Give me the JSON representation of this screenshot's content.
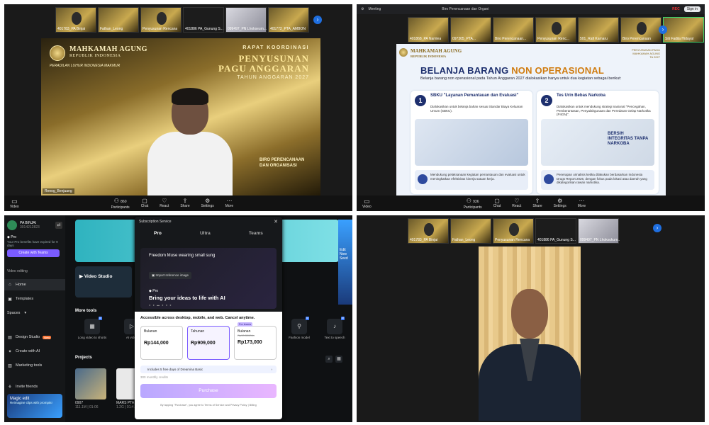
{
  "q1": {
    "participants": [
      "401783_PA Binjai",
      "Fathan_Leong",
      "Penyusunan Rencana",
      "401886 PA_Gunung S...",
      "099497_PN Lhokseum...",
      "401772_PTA_AMBON"
    ],
    "banner": {
      "institution": "MAHKAMAH AGUNG",
      "republic": "REPUBLIK INDONESIA",
      "motto": "PERADILAN LUHUR INDONESIA MAKMUR",
      "meeting": "RAPAT KOORDINASI",
      "title_line1": "PENYUSUNAN",
      "title_line2": "PAGU ANGGARAN",
      "year": "TAHUN ANGGARAN 2027",
      "dept_line1": "BIRO PERENCANAAN",
      "dept_line2": "DAN ORGANISASI"
    },
    "name_tag": "Renog_Benjuang",
    "toolbar": {
      "video": "Video",
      "participants": "Participants",
      "participants_count": "860",
      "chat": "Chat",
      "react": "React",
      "share": "Share",
      "settings": "Settings",
      "more": "More"
    }
  },
  "q2": {
    "browser": {
      "tab": "Meeting",
      "title": "Biro Perencanaan dan Organi",
      "rec": "REC",
      "signin": "Sign in"
    },
    "participants": [
      "401868_PA Namlea",
      "097305_PTA...",
      "Biro Perencanaan...",
      "Penyusunan Renc...",
      "501_Rafi Kamaru",
      "Biro Perencanaan",
      "Siti Fadila Hidayat"
    ],
    "slide": {
      "header_main": "MAHKAMAH AGUNG",
      "header_sub": "REPUBLIK INDONESIA",
      "header_right_1": "PENYUSUNAN PAGU",
      "header_right_2": "MAHKAMAH AGUNG",
      "header_right_3": "TA 2027",
      "title_part1": "BELANJA BARANG ",
      "title_part2": "NON OPERASIONAL",
      "description": "Belanja barang non operasional pada Tahun Anggaran 2027 dialokasikan hanya untuk dua kegiatan sebagai berikut:",
      "card1": {
        "num": "1",
        "title": "SBKU \"Layanan Pemantauan dan Evaluasi\"",
        "desc": "Dialokasikan untuk belanja bahan sesuai Standar Biaya Keluaran Umum (SBKU).",
        "foot": "Mendukung pelaksanaan kegiatan pemantauan dan evaluasi untuk meningkatkan efektivitas kinerja satuan kerja."
      },
      "card2": {
        "num": "2",
        "title": "Tes Urin Bebas Narkoba",
        "desc": "Dialokasikan untuk mendukung strategi nasional \"Pencegahan, Pemberantasan, Penyalahgunaan dan Peredaran Gelap Narkotika (P4GN)\".",
        "label": "BERSIH INTEGRITAS TANPA NARKOBA",
        "foot": "Penerapan urinalisis ketika dilakukan berdasarkan Indonesia Drugs Report 2026, dengan fokus pada lokasi atau daerah yang dikategorikan rawan narkotika."
      }
    },
    "toolbar": {
      "video": "Video",
      "participants": "Participants",
      "participants_count": "936",
      "chat": "Chat",
      "react": "React",
      "share": "Share",
      "settings": "Settings",
      "more": "More"
    }
  },
  "q3": {
    "workspace_name": "PA BINJAI",
    "workspace_id": "3014212823",
    "pro_label": "Pro",
    "pro_note": "Your Pro benefits have expired for 9 days",
    "create_teams": "Create with Teams",
    "section": "Video editing",
    "nav": [
      "Home",
      "Templates",
      "Spaces",
      "Design Studio",
      "Create with AI",
      "Marketing tools",
      "Invite friends"
    ],
    "new_badge": "New",
    "magic_title": "Magic edit",
    "magic_sub": "Reimagine clips with prompts!",
    "video_studio": "Video Studio",
    "more_tools": "More tools",
    "tools": [
      "Long video to shorts",
      "AI video",
      "Fashion model",
      "Text to speech"
    ],
    "projects": "Projects",
    "project1": {
      "name": "0907",
      "meta": "111.1M | 01:06"
    },
    "project2": {
      "name": "MARS PTA",
      "meta": "1.2G | 01:4..."
    },
    "right_promo": "Edit Now Seed",
    "modal": {
      "title": "Subscription Service",
      "tabs": [
        "Pro",
        "Ultra",
        "Teams"
      ],
      "prompt": "Freedom Muse wearing small sung",
      "import_ref": "Import reference image",
      "pro": "Pro",
      "headline": "Bring your ideas to life with AI",
      "access": "Accessible across desktop, mobile, and web. Cancel anytime.",
      "plans": [
        {
          "name": "Bulanan",
          "price": "Rp144,000",
          "old": "",
          "tag": ""
        },
        {
          "name": "Tahunan",
          "price": "Rp909,000",
          "old": "",
          "tag": ""
        },
        {
          "name": "Bulanan",
          "price": "Rp173,000",
          "old": "Rp90,300/bln",
          "tag": "For teams"
        }
      ],
      "dreamina": "Includes 5 free days of Dreamina Basic",
      "credits": "300 monthly credits",
      "purchase": "Purchase",
      "legal": "By tapping \"Purchase\", you agree to Terms of Service and Privacy Policy | Billing"
    }
  },
  "q4": {
    "participants": [
      "401783_PA Binjai",
      "Fathan_Leong",
      "Penyusunan Rencana",
      "401886 PA_Gunung S...",
      "099497_PN Lhoksukum..."
    ]
  },
  "colors": {
    "gold": "#c9a94f",
    "navy": "#1d2f6e",
    "orange": "#d07c10",
    "purple": "#7b5cff",
    "zoom_blue": "#1f6fe0"
  }
}
